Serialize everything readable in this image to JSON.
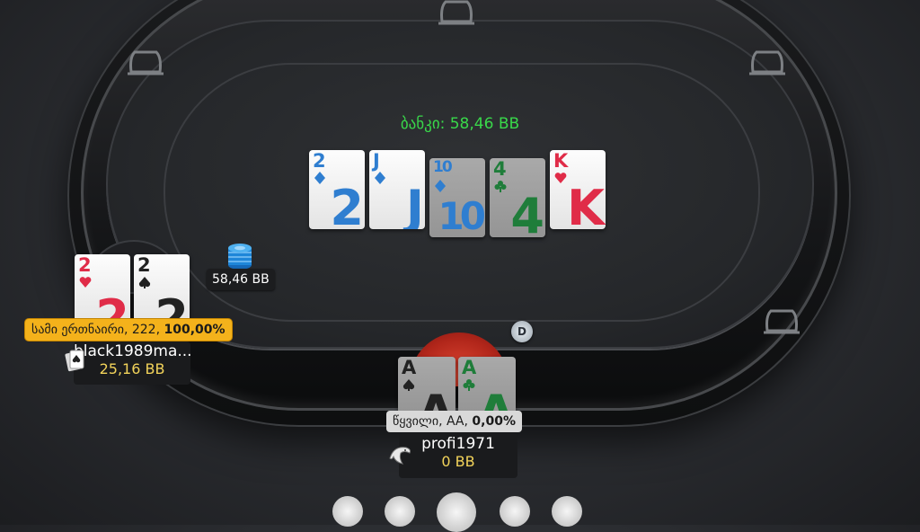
{
  "pot": {
    "label": "ბანკი: 58,46 BB"
  },
  "board": [
    {
      "rank": "2",
      "suit": "diamonds",
      "color": "#2f7ed0",
      "dim": false
    },
    {
      "rank": "J",
      "suit": "diamonds",
      "color": "#2f7ed0",
      "dim": false
    },
    {
      "rank": "10",
      "suit": "diamonds",
      "color": "#2f7ed0",
      "dim": true
    },
    {
      "rank": "4",
      "suit": "clubs",
      "color": "#1f7d3a",
      "dim": true
    },
    {
      "rank": "K",
      "suit": "hearts",
      "color": "#e02c48",
      "dim": false
    }
  ],
  "bet": {
    "amount": "58,46 BB"
  },
  "players": {
    "left": {
      "name": "black1989ma...",
      "stack": "25,16 BB",
      "hand_result": "სამი ერთნაირი, 222, ",
      "hand_equity": "100,00%",
      "cards": [
        {
          "rank": "2",
          "suit": "hearts",
          "color": "#e02c48"
        },
        {
          "rank": "2",
          "suit": "spades",
          "color": "#222222"
        }
      ]
    },
    "bottom": {
      "name": "profi1971",
      "stack": "0 BB",
      "hand_result": "წყვილი, AA, ",
      "hand_equity": "0,00%",
      "cards": [
        {
          "rank": "A",
          "suit": "spades",
          "color": "#222222"
        },
        {
          "rank": "A",
          "suit": "clubs",
          "color": "#1f7d3a"
        }
      ]
    }
  },
  "dealer_button": {
    "label": "D"
  },
  "colors": {
    "pot_text": "#39d84a",
    "stack_text": "#f2d35a",
    "win_tag": "#f4b21b",
    "lose_tag": "#d9d9d9"
  },
  "icons": [
    "empty-seat-icon",
    "chip-stack-icon",
    "avatar-card-icon",
    "avatar-dolphin-icon"
  ]
}
